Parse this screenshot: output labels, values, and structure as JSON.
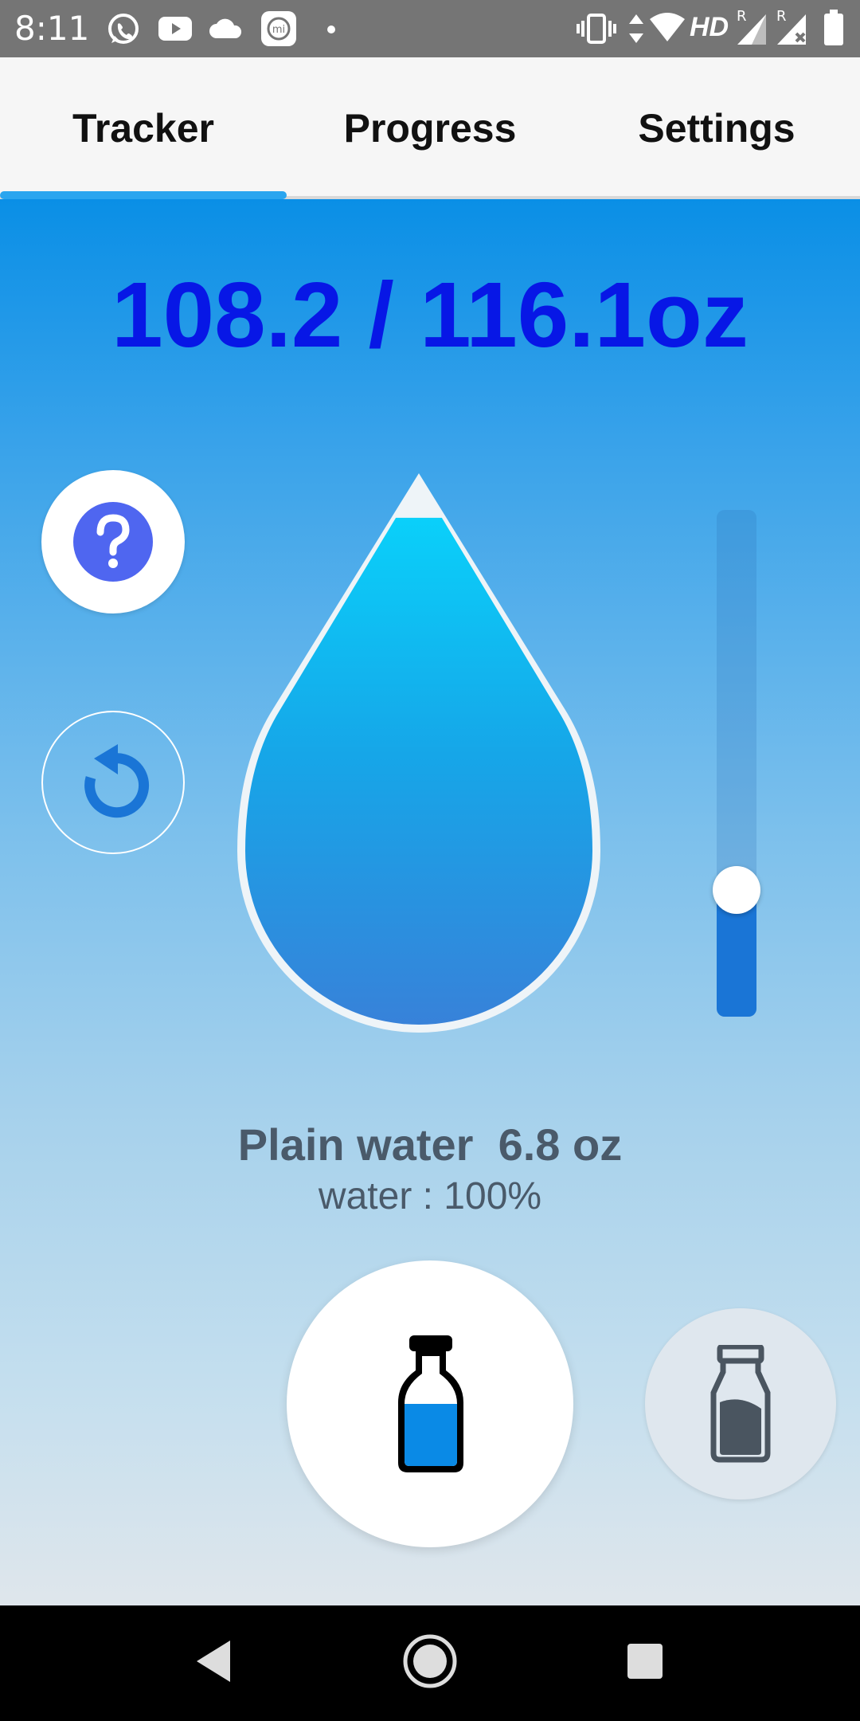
{
  "status_bar": {
    "time": "8:11",
    "icons_left": [
      "whatsapp-icon",
      "youtube-icon",
      "cloud-icon",
      "mi-app-icon",
      "dot-icon"
    ],
    "icons_right": [
      "vibrate-icon",
      "data-arrows-icon",
      "wifi-icon",
      "hd-icon",
      "signal-icon",
      "signal-no-data-icon",
      "battery-icon"
    ],
    "hd_label": "HD",
    "roaming_label": "R"
  },
  "tabs": {
    "items": [
      {
        "label": "Tracker",
        "selected": true
      },
      {
        "label": "Progress",
        "selected": false
      },
      {
        "label": "Settings",
        "selected": false
      }
    ]
  },
  "tracker": {
    "total_text": "108.2 / 116.1oz",
    "drink_name_text": "Plain water  6.8 oz",
    "drink_composition_text": "water : 100%",
    "drop_fill_fraction": 0.93,
    "slider_value_fraction": 0.25,
    "help_icon": "question-icon",
    "undo_icon": "undo-icon",
    "add_icon": "water-bottle-icon",
    "container_icon": "milk-bottle-icon",
    "colors": {
      "total_text": "#0717e6",
      "accent": "#1a75d6",
      "help_circle": "#4f66f0",
      "bottle_fill": "#0a8ae6"
    }
  },
  "navbar": {
    "icons": [
      "back-icon",
      "home-icon",
      "recents-icon"
    ]
  }
}
